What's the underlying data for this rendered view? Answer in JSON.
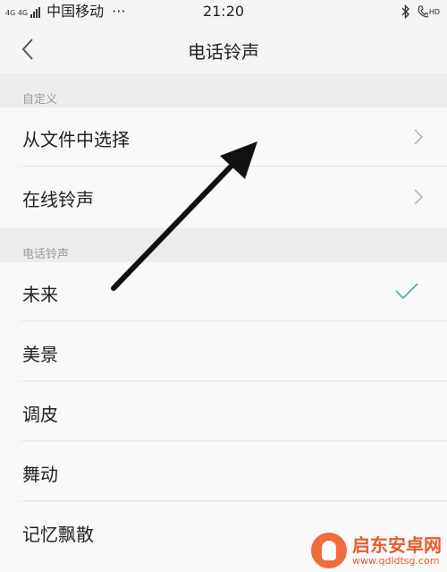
{
  "status_bar": {
    "signal_text": "4G 4G",
    "carrier": "中国移动",
    "dots": "···",
    "time": "21:20",
    "hd_label": "HD"
  },
  "nav": {
    "title": "电话铃声"
  },
  "sections": [
    {
      "header": "自定义",
      "items": [
        {
          "label": "从文件中选择",
          "chevron": true
        },
        {
          "label": "在线铃声",
          "chevron": true
        }
      ]
    },
    {
      "header": "电话铃声",
      "items": [
        {
          "label": "未来",
          "selected": true
        },
        {
          "label": "美景"
        },
        {
          "label": "调皮"
        },
        {
          "label": "舞动"
        },
        {
          "label": "记忆飘散"
        }
      ]
    }
  ],
  "watermark": {
    "title": "启东安卓网",
    "url": "www.qdldtsg.com"
  },
  "colors": {
    "accent_check": "#4fb3a7",
    "arrow": "#111111",
    "background": "#f5f5f5"
  }
}
